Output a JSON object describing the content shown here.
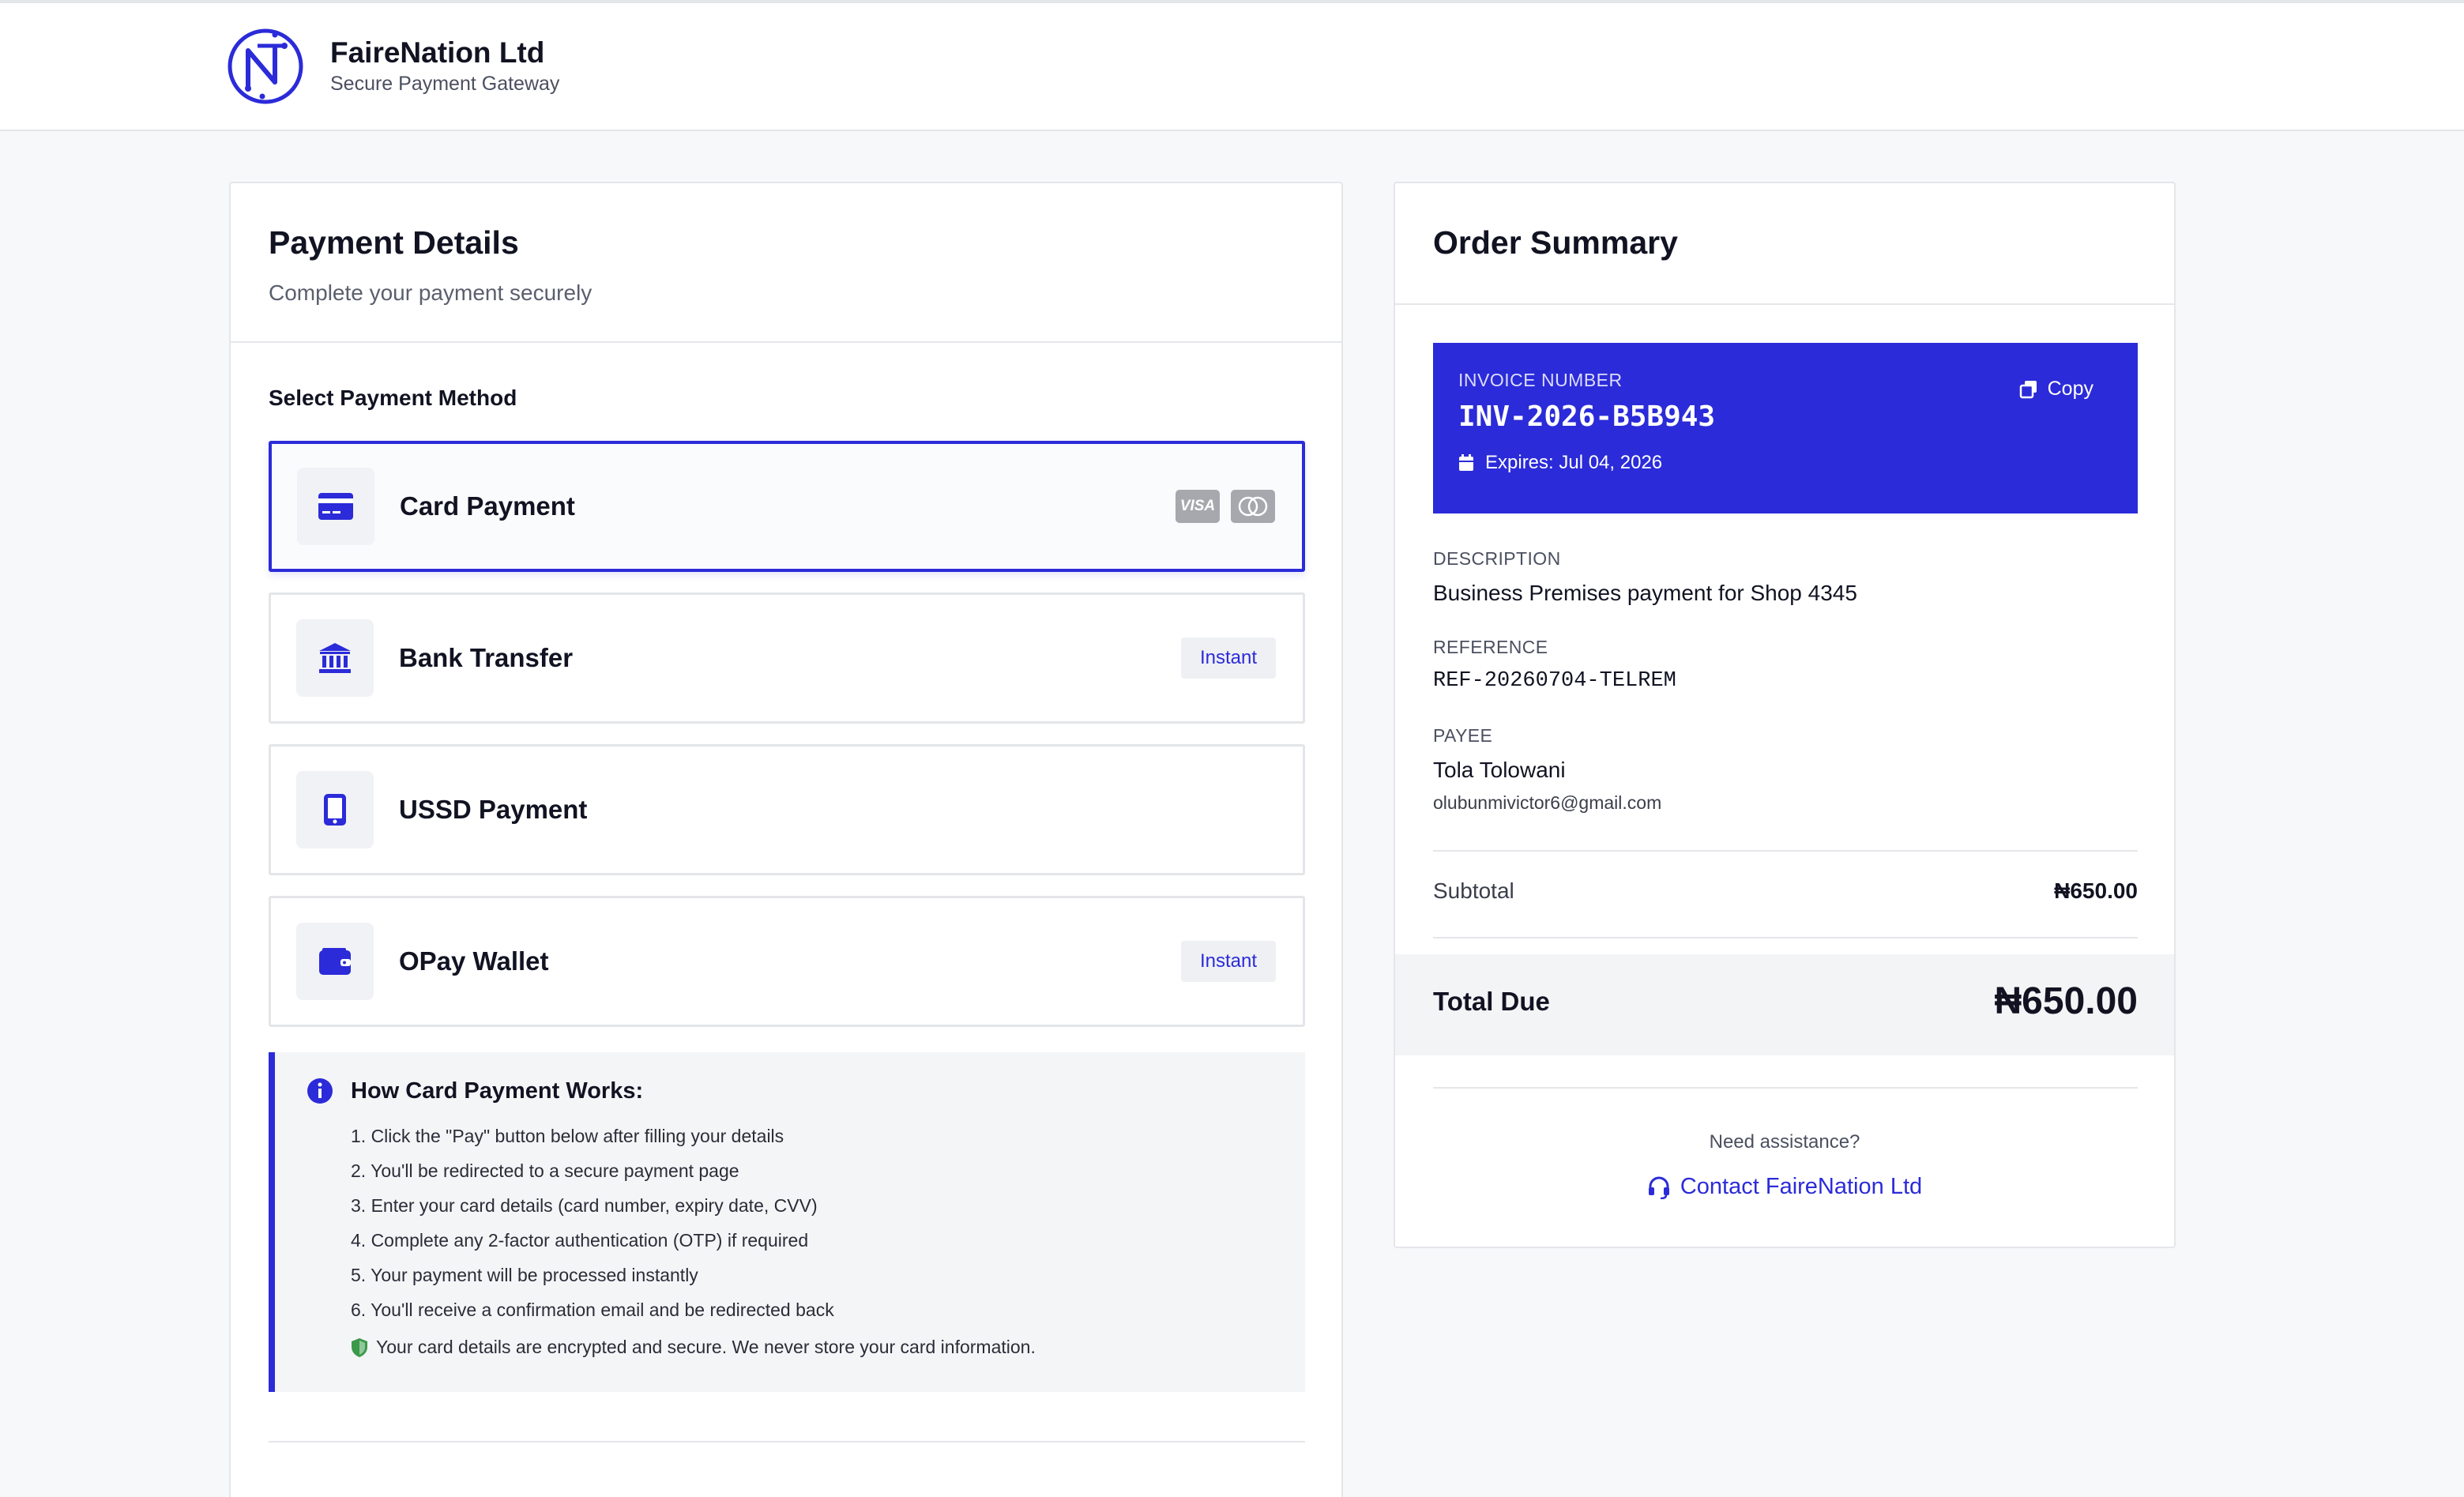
{
  "brand": {
    "name": "FaireNation Ltd",
    "subtitle": "Secure Payment Gateway"
  },
  "payment": {
    "title": "Payment Details",
    "subtitle": "Complete your payment securely",
    "method_label": "Select Payment Method",
    "methods": [
      {
        "label": "Card Payment",
        "icon": "credit-card-icon",
        "selected": true
      },
      {
        "label": "Bank Transfer",
        "icon": "bank-icon",
        "badge": "Instant"
      },
      {
        "label": "USSD Payment",
        "icon": "mobile-phone-icon"
      },
      {
        "label": "OPay Wallet",
        "icon": "wallet-icon",
        "badge": "Instant"
      }
    ],
    "card_logos": {
      "visa": "VISA"
    },
    "info": {
      "title": "How Card Payment Works:",
      "steps": [
        "1. Click the \"Pay\" button below after filling your details",
        "2. You'll be redirected to a secure payment page",
        "3. Enter your card details (card number, expiry date, CVV)",
        "4. Complete any 2-factor authentication (OTP) if required",
        "5. Your payment will be processed instantly",
        "6. You'll receive a confirmation email and be redirected back"
      ],
      "security_note": "Your card details are encrypted and secure. We never store your card information."
    }
  },
  "order": {
    "title": "Order Summary",
    "invoice": {
      "label": "INVOICE NUMBER",
      "number": "INV-2026-B5B943",
      "expires": "Expires: Jul 04, 2026",
      "copy_label": "Copy"
    },
    "description": {
      "label": "DESCRIPTION",
      "value": "Business Premises payment for Shop 4345"
    },
    "reference": {
      "label": "REFERENCE",
      "value": "REF-20260704-TELREM"
    },
    "payee": {
      "label": "PAYEE",
      "name": "Tola Tolowani",
      "email": "olubunmivictor6@gmail.com"
    },
    "subtotal": {
      "label": "Subtotal",
      "value": "₦650.00"
    },
    "total": {
      "label": "Total Due",
      "value": "₦650.00"
    },
    "help": {
      "text": "Need assistance?",
      "contact": "Contact FaireNation Ltd"
    }
  },
  "colors": {
    "accent": "#2b2bd9",
    "background": "#f7f8fa",
    "border": "#e4e6ea",
    "secure_green": "#3a9a4a"
  }
}
